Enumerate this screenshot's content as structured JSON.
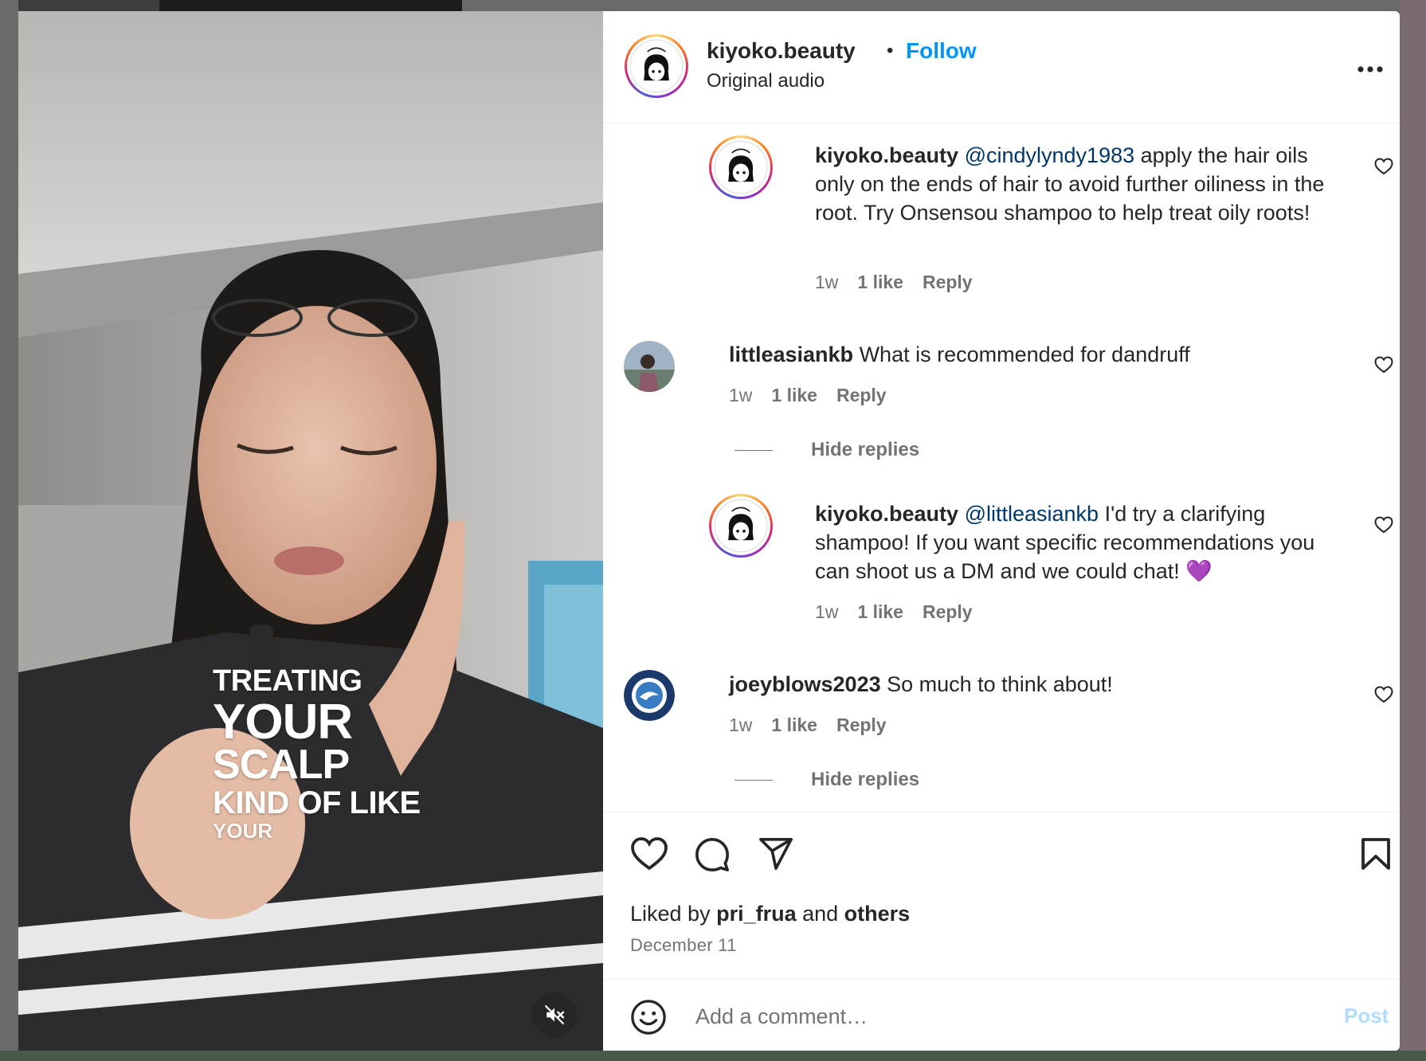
{
  "post": {
    "username": "kiyoko.beauty",
    "dot": "•",
    "follow_label": "Follow",
    "audio": "Original audio",
    "more_icon": "more-horizontal-icon"
  },
  "video": {
    "overlay": [
      "TREATING",
      "YOUR",
      "SCALP",
      "KIND OF LIKE",
      "YOUR"
    ],
    "mute_icon": "muted-speaker-icon"
  },
  "comments": [
    {
      "username": "kiyoko.beauty",
      "mention": "@cindylyndy1983",
      "text": " apply the hair oils only on the ends of hair to avoid further oiliness in the root. Try Onsensou shampoo to help treat oily roots!",
      "time": "1w",
      "likes": "1 like",
      "reply": "Reply"
    },
    {
      "username": "littleasiankb",
      "mention": "",
      "text": " What is recommended for dandruff",
      "time": "1w",
      "likes": "1 like",
      "reply": "Reply",
      "hide_replies": "Hide replies"
    },
    {
      "username": "kiyoko.beauty",
      "mention": "@littleasiankb",
      "text": " I'd try a clarifying shampoo! If you want specific recommendations you can shoot us a DM and we could chat! 💜",
      "time": "1w",
      "likes": "1 like",
      "reply": "Reply"
    },
    {
      "username": "joeyblows2023",
      "mention": "",
      "text": " So much to think about!",
      "time": "1w",
      "likes": "1 like",
      "reply": "Reply",
      "hide_replies": "Hide replies"
    }
  ],
  "likes": {
    "prefix": "Liked by ",
    "user": "pri_frua",
    "mid": " and ",
    "others": "others"
  },
  "date": "December 11",
  "add_comment": {
    "placeholder": "Add a comment…",
    "post_label": "Post"
  },
  "colors": {
    "link": "#0095f6",
    "mention": "#00376b",
    "muted_text": "#737373",
    "post_disabled": "#b3dbff"
  }
}
